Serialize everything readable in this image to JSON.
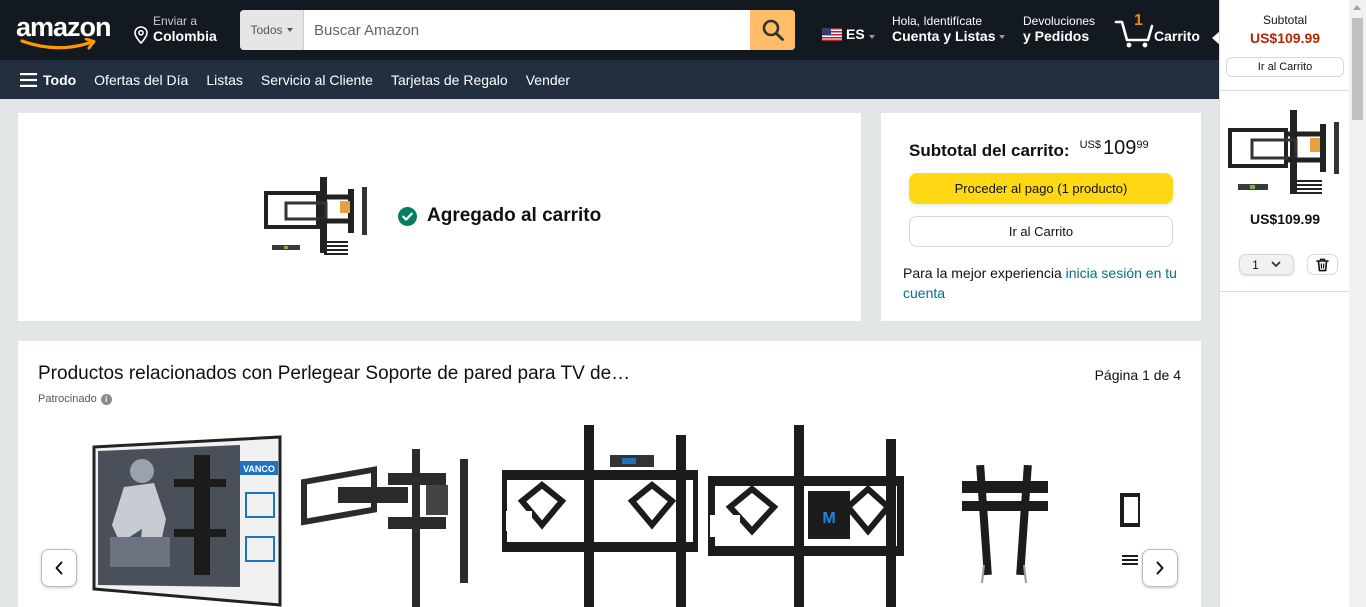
{
  "header": {
    "logo_text": "amazon",
    "deliver_line1": "Enviar a",
    "deliver_line2": "Colombia",
    "search": {
      "category": "Todos",
      "placeholder": "Buscar Amazon"
    },
    "lang": "ES",
    "account_line1": "Hola, Identifícate",
    "account_line2": "Cuenta y Listas",
    "returns_line1": "Devoluciones",
    "returns_line2": "y Pedidos",
    "cart_count": "1",
    "cart_label": "Carrito"
  },
  "subnav": {
    "all_label": "Todo",
    "links": [
      "Ofertas del Día",
      "Listas",
      "Servicio al Cliente",
      "Tarjetas de Regalo",
      "Vender"
    ]
  },
  "added": {
    "message": "Agregado al carrito"
  },
  "subtotal": {
    "label": "Subtotal del carrito:",
    "currency": "US$",
    "whole": "109",
    "fraction": "99",
    "checkout_label": "Proceder al pago (1 producto)",
    "goto_cart_label": "Ir al Carrito",
    "signin_prefix": "Para la mejor experiencia ",
    "signin_link": "inicia sesión en tu cuenta"
  },
  "related": {
    "title": "Productos relacionados con Perlegear Soporte de pared para TV de…",
    "page": "Página 1 de 4",
    "sponsored": "Patrocinado",
    "brand_badge": "VANCO"
  },
  "flyout": {
    "subtotal_label": "Subtotal",
    "subtotal_value": "US$109.99",
    "goto_cart_label": "Ir al Carrito",
    "item_price": "US$109.99",
    "qty": "1"
  },
  "colors": {
    "nav_bg": "#131921",
    "subnav_bg": "#232f3e",
    "search_button": "#febd69",
    "checkout_button": "#ffd814",
    "price_red": "#b12704",
    "link_teal": "#007185",
    "cart_orange": "#f08804",
    "success_green": "#067d62"
  }
}
